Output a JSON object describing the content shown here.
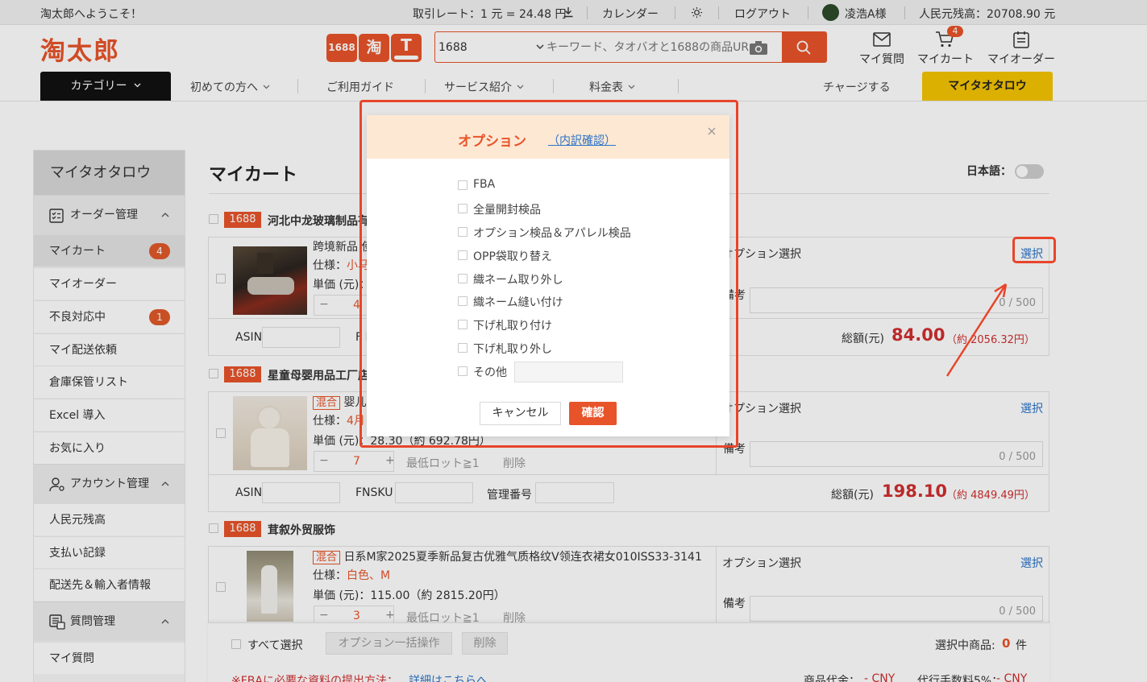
{
  "topbar": {
    "welcome": "淘太郎へようこそ！",
    "rate": "取引レート：1 元 = 24.48 円",
    "calendar": "カレンダー",
    "logout": "ログアウト",
    "user": "凌浩A様",
    "balance": "人民元残高：20708.90 元"
  },
  "header": {
    "logo": "淘太郎",
    "badge_1688": "1688",
    "badge_tao": "淘",
    "search_platform": "1688",
    "search_placeholder": "キーワード、タオバオと1688の商品URL",
    "links": [
      {
        "label": "マイ質問",
        "icon": "envelope-icon"
      },
      {
        "label": "マイカート",
        "icon": "cart-icon",
        "count": "4"
      },
      {
        "label": "マイオーダー",
        "icon": "clipboard-icon"
      }
    ]
  },
  "nav": {
    "category": "カテゴリー",
    "items": [
      "初めての方へ",
      "ご利用ガイド",
      "サービス紹介",
      "料金表"
    ],
    "charge": "チャージする",
    "mytaotarou": "マイタオタロウ"
  },
  "sidebar": {
    "title": "マイタオタロウ",
    "order_section": "オーダー管理",
    "order_items": [
      {
        "label": "マイカート",
        "count": "4"
      },
      {
        "label": "マイオーダー"
      },
      {
        "label": "不良対応中",
        "count": "1"
      },
      {
        "label": "マイ配送依頼"
      },
      {
        "label": "倉庫保管リスト"
      },
      {
        "label": "Excel 導入"
      },
      {
        "label": "お気に入り"
      }
    ],
    "account_section": "アカウント管理",
    "account_items": [
      {
        "label": "人民元残高"
      },
      {
        "label": "支払い記録"
      },
      {
        "label": "配送先＆輸入者情報"
      }
    ],
    "question_section": "質問管理",
    "question_items": [
      {
        "label": "マイ質問"
      }
    ]
  },
  "main": {
    "title": "マイカート",
    "lang_label": "日本語："
  },
  "cart": {
    "common": {
      "tag": "1688",
      "option_select": "オプション選択",
      "select_link": "選択",
      "note_label": "備考",
      "note_count": "0 / 500",
      "spec_label": "仕様：",
      "min_lot": "最低ロット≧1",
      "delete": "削除",
      "asin": "ASIN",
      "fnsku": "FNSKU",
      "mgmt": "管理番号",
      "total_label": "総額(元)",
      "mixed_tag": "混合",
      "minus": "−",
      "plus": "+"
    },
    "groups": [
      {
        "shop": "河北中龙玻璃制品有",
        "title": "跨境新品 使",
        "spec": "小马",
        "unit_price": "単価 (元)：",
        "qty": "4",
        "total": "84.00",
        "total_jpy": "（約 2056.32円）"
      },
      {
        "shop": "星童母婴用品工厂店",
        "title": "婴儿",
        "spec": "4月",
        "unit_price": "単価 (元)：28.30（約 692.78円）",
        "qty": "7",
        "total": "198.10",
        "total_jpy": "（約 4849.49円）"
      },
      {
        "shop": "茸叙外贸服饰",
        "title": "日系M家2025夏季新品复古优雅气质格纹V领连衣裙女010ISS33-3141",
        "spec": "白色、M",
        "unit_price": "単価 (元)：115.00（約 2815.20円）",
        "qty": "3"
      }
    ]
  },
  "bottom": {
    "select_all": "すべて選択",
    "bulk_option": "オプション一括操作",
    "delete": "削除",
    "selected_label": "選択中商品:",
    "selected_count": "0",
    "selected_unit": "件",
    "fba_note": "※FBAに必要な資料の提出方法：",
    "fba_link": "詳細はこちらへ",
    "goods_price": "商品代金：",
    "goods_value": "- CNY",
    "fee_label": "代行手数料5%：",
    "fee_value": "- CNY"
  },
  "modal": {
    "title": "オプション",
    "detail_link": "（内訳確認）",
    "options": [
      "FBA",
      "全量開封検品",
      "オプション検品＆アパレル検品",
      "OPP袋取り替え",
      "織ネーム取り外し",
      "織ネーム縫い付け",
      "下げ札取り付け",
      "下げ札取り外し",
      "その他"
    ],
    "cancel": "キャンセル",
    "confirm": "確認"
  },
  "colors": {
    "brand": "#e8542a",
    "annotation": "#e8452a",
    "link": "#2a73c9",
    "accent_yellow": "#f4c400"
  }
}
